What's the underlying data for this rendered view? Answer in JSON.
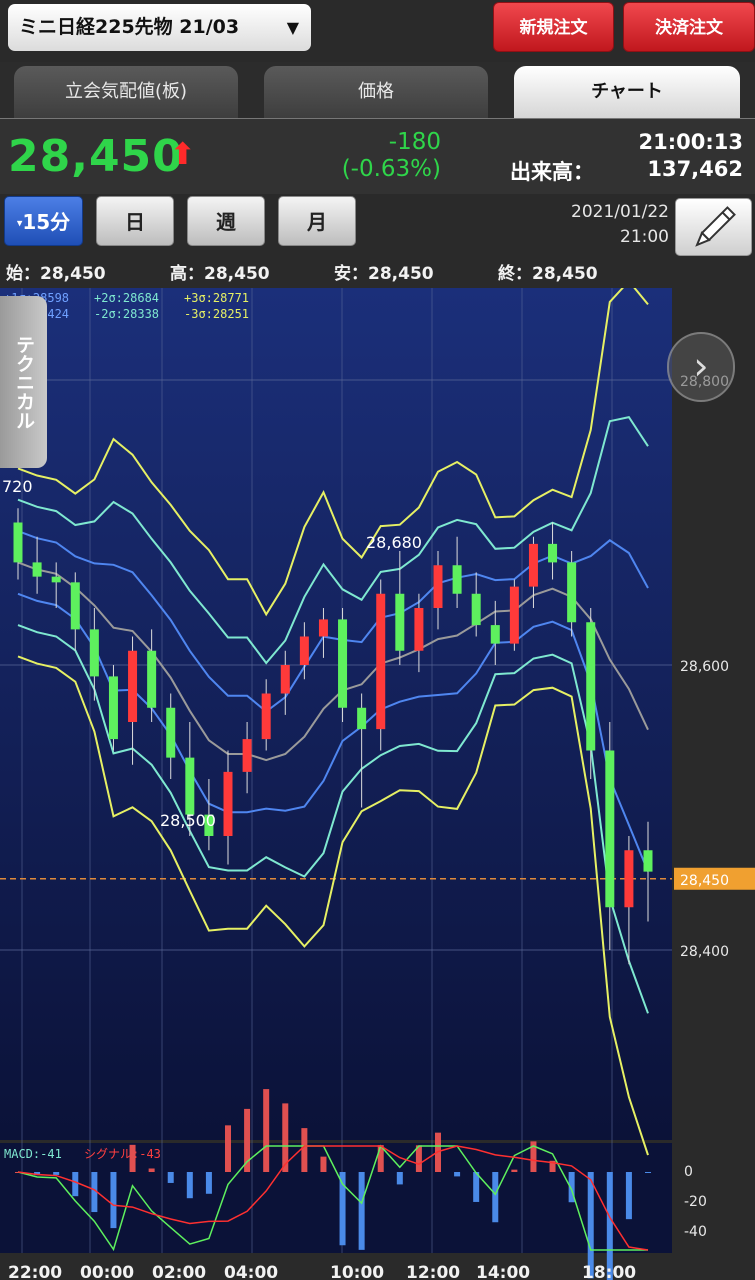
{
  "header": {
    "symbol": "ミニ日経225先物 21/03",
    "caret": "▼",
    "new_order": "新規注文",
    "settle_order": "決済注文"
  },
  "tabs": [
    "立会気配値(板)",
    "価格",
    "チャート"
  ],
  "quote": {
    "price": "28,450",
    "arrow": "⬆",
    "change": "-180",
    "change_pct": "(-0.63%)",
    "time": "21:00:13",
    "volume_label": "出来高：",
    "volume": "137,462"
  },
  "intervals": {
    "selected": "15分",
    "marker": "▾",
    "day": "日",
    "week": "週",
    "month": "月"
  },
  "datetime": {
    "date": "2021/01/22",
    "time": "21:00"
  },
  "ohlc": {
    "open": "始：28,450",
    "high": "高：28,450",
    "low": "安：28,450",
    "close": "終：28,450"
  },
  "chart": {
    "technical_label": "テクニカル",
    "next_icon": "chevron-right-icon",
    "bb_legend_row1": [
      {
        "text": "+1σ:28598",
        "color": "#6fa0ff"
      },
      {
        "text": "+2σ:28684",
        "color": "#7fe8d0"
      },
      {
        "text": "+3σ:28771",
        "color": "#e6f064"
      }
    ],
    "bb_legend_row2": [
      {
        "text": "-1σ:28424",
        "color": "#6fa0ff"
      },
      {
        "text": "-2σ:28338",
        "color": "#7fe8d0"
      },
      {
        "text": "-3σ:28251",
        "color": "#e6f064"
      }
    ],
    "annotations": [
      "720",
      "28,680",
      "28,500"
    ],
    "current_price_tag": "28,450",
    "macd_label": "MACD:-41",
    "signal_label": "シグナル:-43",
    "macd_ticks": [
      "0",
      "-20",
      "-40"
    ],
    "x_ticks": [
      "22:00",
      "00:00",
      "02:00",
      "04:00",
      "10:00",
      "12:00",
      "14:00",
      "18:00"
    ]
  },
  "chart_data": {
    "type": "candlestick",
    "y_ticks": [
      28800,
      28600,
      28450,
      28400
    ],
    "ylim": [
      28250,
      28920
    ],
    "candles": [
      [
        28700,
        28710,
        28660,
        28672
      ],
      [
        28672,
        28690,
        28650,
        28662
      ],
      [
        28662,
        28672,
        28640,
        28658
      ],
      [
        28658,
        28665,
        28610,
        28625
      ],
      [
        28625,
        28640,
        28575,
        28592
      ],
      [
        28592,
        28600,
        28540,
        28548
      ],
      [
        28560,
        28620,
        28530,
        28610
      ],
      [
        28610,
        28625,
        28560,
        28570
      ],
      [
        28570,
        28580,
        28520,
        28535
      ],
      [
        28535,
        28560,
        28480,
        28495
      ],
      [
        28495,
        28520,
        28470,
        28480
      ],
      [
        28480,
        28540,
        28460,
        28525
      ],
      [
        28525,
        28560,
        28510,
        28548
      ],
      [
        28548,
        28590,
        28540,
        28580
      ],
      [
        28580,
        28610,
        28565,
        28600
      ],
      [
        28600,
        28630,
        28590,
        28620
      ],
      [
        28620,
        28640,
        28605,
        28632
      ],
      [
        28632,
        28640,
        28560,
        28570
      ],
      [
        28570,
        28580,
        28500,
        28555
      ],
      [
        28555,
        28660,
        28540,
        28650
      ],
      [
        28650,
        28680,
        28600,
        28610
      ],
      [
        28610,
        28650,
        28595,
        28640
      ],
      [
        28640,
        28680,
        28625,
        28670
      ],
      [
        28670,
        28690,
        28640,
        28650
      ],
      [
        28650,
        28665,
        28620,
        28628
      ],
      [
        28628,
        28645,
        28600,
        28615
      ],
      [
        28615,
        28660,
        28610,
        28655
      ],
      [
        28655,
        28690,
        28640,
        28685
      ],
      [
        28685,
        28700,
        28660,
        28672
      ],
      [
        28672,
        28680,
        28620,
        28630
      ],
      [
        28630,
        28640,
        28520,
        28540
      ],
      [
        28540,
        28560,
        28400,
        28430
      ],
      [
        28430,
        28480,
        28390,
        28470
      ],
      [
        28470,
        28490,
        28420,
        28455
      ]
    ]
  }
}
